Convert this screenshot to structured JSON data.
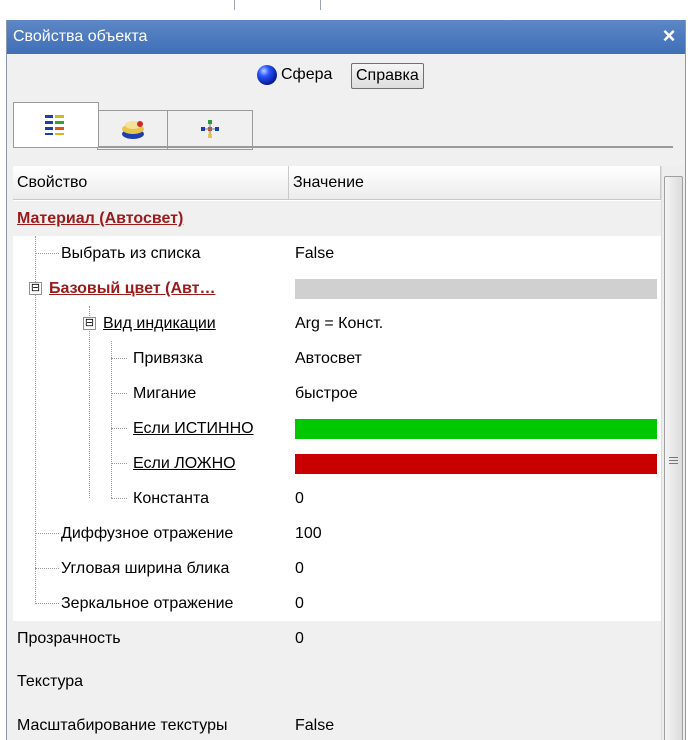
{
  "panel": {
    "title": "Свойства объекта",
    "close": "×"
  },
  "object": {
    "name": "Сфера",
    "help_label": "Справка"
  },
  "grid": {
    "header": {
      "property": "Свойство",
      "value": "Значение"
    },
    "rows": [
      {
        "name": "Материал (Автосвет)",
        "value": ""
      },
      {
        "name": "Выбрать из списка",
        "value": "False"
      },
      {
        "name": "Базовый цвет (Авт…",
        "value": "",
        "toggle": "⊟"
      },
      {
        "name": "Вид индикации",
        "value": "Arg = Конст.",
        "toggle": "⊟"
      },
      {
        "name": "Привязка",
        "value": "Автосвет"
      },
      {
        "name": "Мигание",
        "value": "быстрое"
      },
      {
        "name": "Если ИСТИННО",
        "value": ""
      },
      {
        "name": "Если ЛОЖНО",
        "value": ""
      },
      {
        "name": "Константа",
        "value": "0"
      },
      {
        "name": "Диффузное отражение",
        "value": "100"
      },
      {
        "name": "Угловая ширина блика",
        "value": "0"
      },
      {
        "name": "Зеркальное отражение",
        "value": "0"
      },
      {
        "name": "Прозрачность",
        "value": "0"
      },
      {
        "name": "Текстура",
        "value": ""
      },
      {
        "name": "Масштабирование текстуры",
        "value": "False"
      }
    ]
  },
  "colors": {
    "true_color": "#00c800",
    "false_color": "#c80000",
    "base_color": "#d0d0d0",
    "category_text": "#9b1b1b"
  },
  "icons": {
    "tab1": "property-list-icon",
    "tab2": "material-icon",
    "tab3": "animation-icon",
    "object": "sphere-icon"
  }
}
